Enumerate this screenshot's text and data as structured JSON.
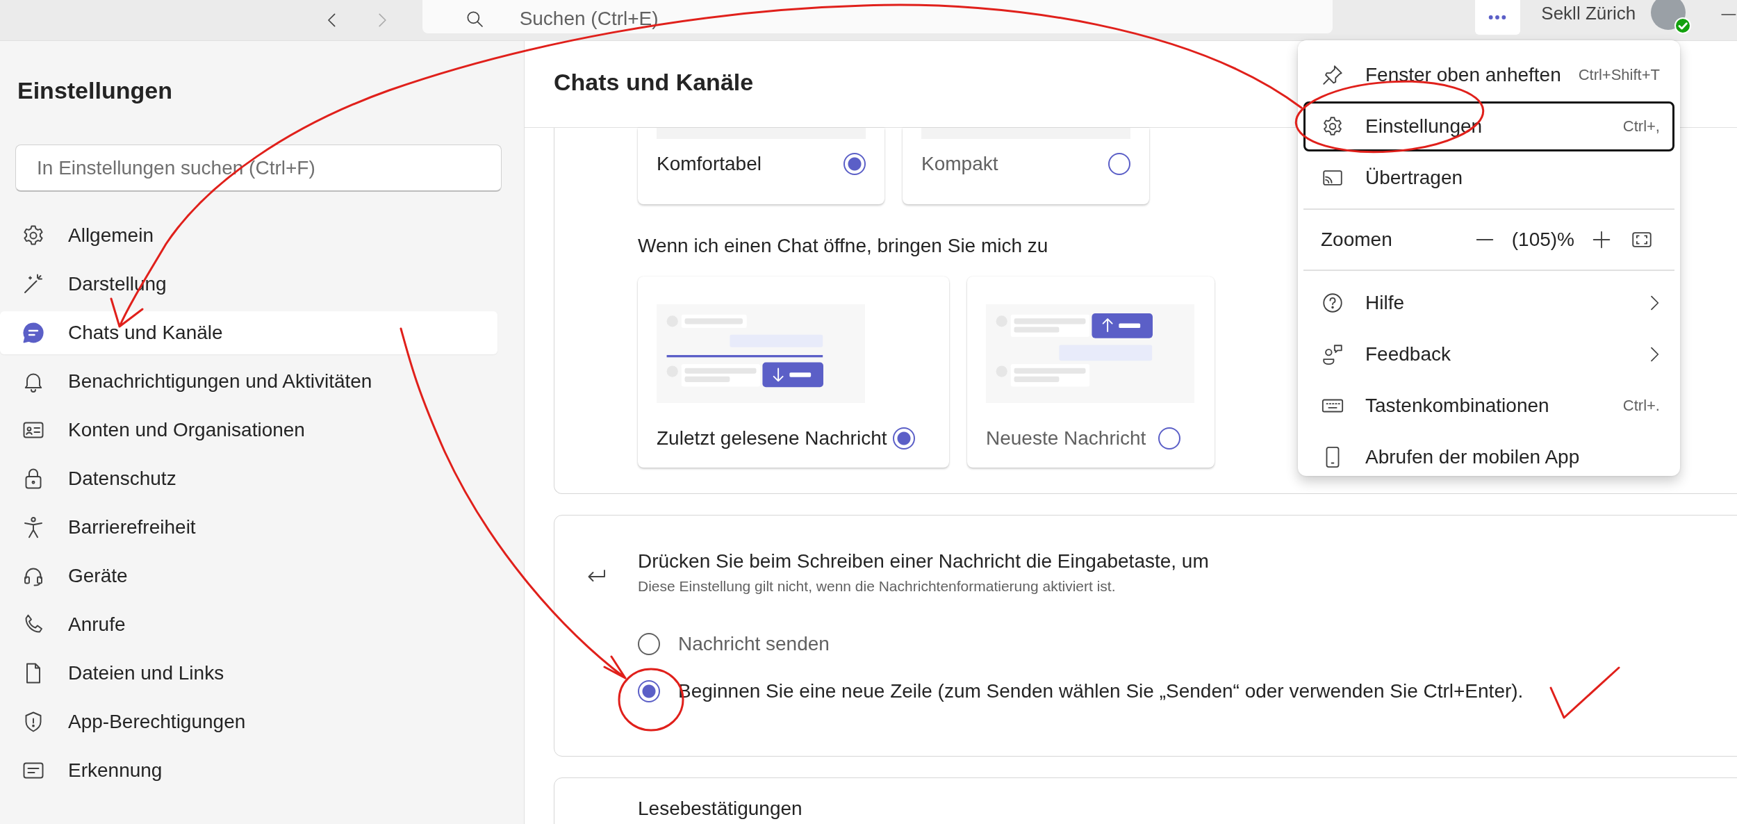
{
  "topbar": {
    "search": {
      "placeholder": "Suchen (Ctrl+E)"
    },
    "user": {
      "name": "Sekll Zürich"
    }
  },
  "sidebar": {
    "title": "Einstellungen",
    "search": {
      "placeholder": "In Einstellungen suchen (Ctrl+F)"
    },
    "items": [
      {
        "label": "Allgemein",
        "selected": false
      },
      {
        "label": "Darstellung",
        "selected": false
      },
      {
        "label": "Chats und Kanäle",
        "selected": true
      },
      {
        "label": "Benachrichtigungen und Aktivitäten",
        "selected": false
      },
      {
        "label": "Konten und Organisationen",
        "selected": false
      },
      {
        "label": "Datenschutz",
        "selected": false
      },
      {
        "label": "Barrierefreiheit",
        "selected": false
      },
      {
        "label": "Geräte",
        "selected": false
      },
      {
        "label": "Anrufe",
        "selected": false
      },
      {
        "label": "Dateien und Links",
        "selected": false
      },
      {
        "label": "App-Berechtigungen",
        "selected": false
      },
      {
        "label": "Erkennung",
        "selected": false
      }
    ]
  },
  "main": {
    "title": "Chats und Kanäle",
    "density": {
      "options": [
        {
          "label": "Komfortabel",
          "selected": true
        },
        {
          "label": "Kompakt",
          "selected": false
        }
      ]
    },
    "open_chat": {
      "label": "Wenn ich einen Chat öffne, bringen Sie mich zu",
      "options": [
        {
          "label": "Zuletzt gelesene Nachricht",
          "kind": "last-read",
          "selected": true
        },
        {
          "label": "Neueste Nachricht",
          "kind": "newest",
          "selected": false
        }
      ]
    },
    "enter_key": {
      "title": "Drücken Sie beim Schreiben einer Nachricht die Eingabetaste, um",
      "hint": "Diese Einstellung gilt nicht, wenn die Nachrichtenformatierung aktiviert ist.",
      "options": [
        {
          "label": "Nachricht senden",
          "selected": false
        },
        {
          "label": "Beginnen Sie eine neue Zeile (zum Senden wählen Sie „Senden“ oder verwenden Sie Ctrl+Enter).",
          "selected": true
        }
      ]
    },
    "read_receipts": {
      "title": "Lesebestätigungen"
    }
  },
  "menu": {
    "sections": [
      {
        "items": [
          {
            "kind": "command",
            "label": "Fenster oben anheften",
            "shortcut": "Ctrl+Shift+T",
            "focused": false
          },
          {
            "kind": "command",
            "label": "Einstellungen",
            "shortcut": "Ctrl+,",
            "focused": true
          },
          {
            "kind": "command",
            "label": "Übertragen",
            "focused": false
          }
        ]
      },
      {
        "items": [
          {
            "kind": "zoom",
            "label": "Zoomen",
            "value": "(105)%"
          }
        ]
      },
      {
        "items": [
          {
            "kind": "submenu",
            "label": "Hilfe",
            "focused": false
          },
          {
            "kind": "submenu",
            "label": "Feedback",
            "focused": false
          },
          {
            "kind": "command",
            "label": "Tastenkombinationen",
            "shortcut": "Ctrl+.",
            "focused": false
          },
          {
            "kind": "command",
            "label": "Abrufen der mobilen App",
            "focused": false
          }
        ]
      }
    ]
  }
}
